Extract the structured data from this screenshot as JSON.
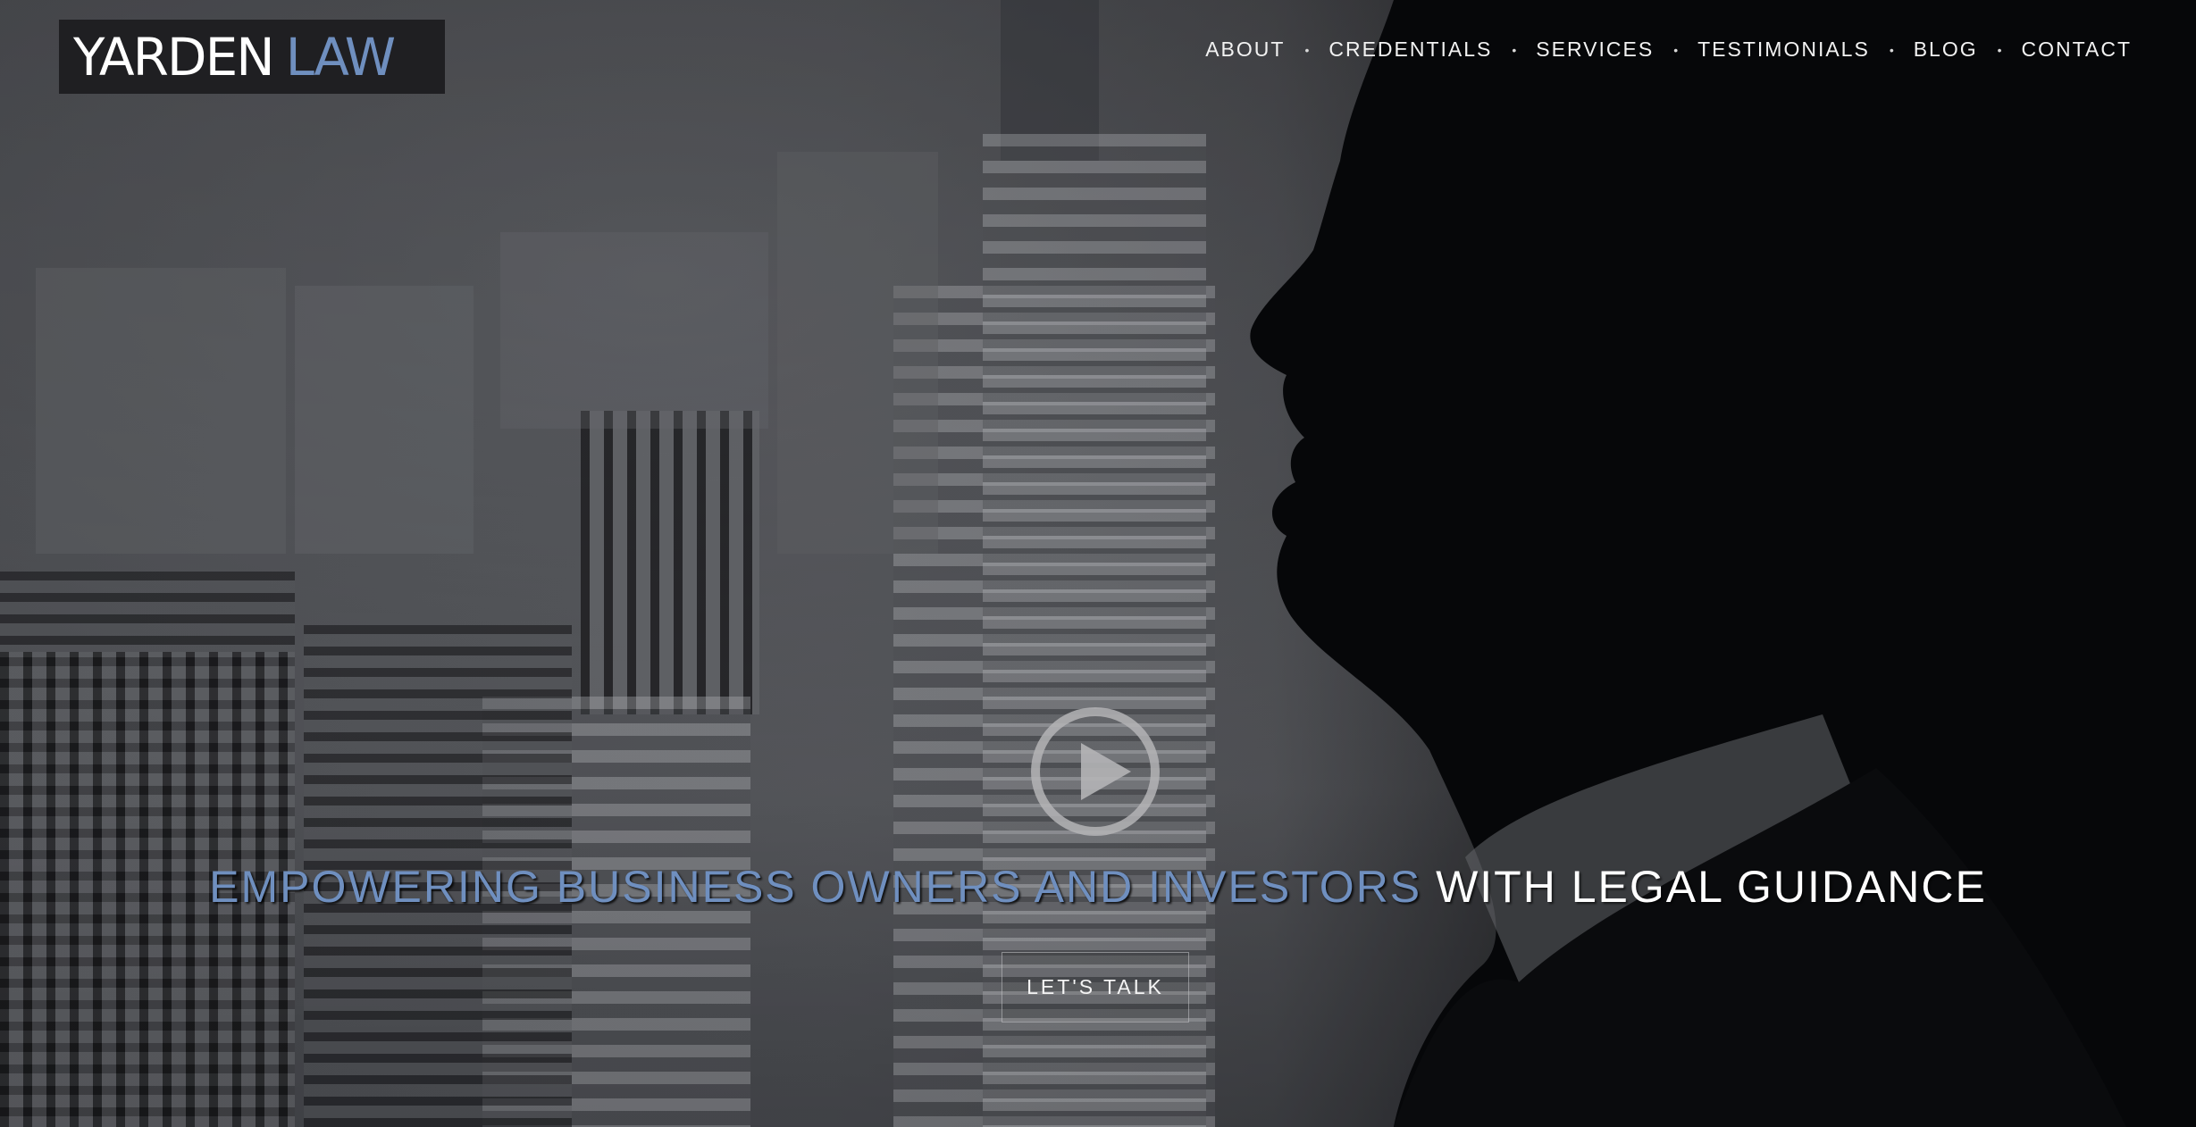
{
  "brand": {
    "name_part1": "YARDEN",
    "name_part2": "LAW",
    "accent_color": "#6f8fbf"
  },
  "nav": {
    "items": [
      {
        "label": "ABOUT"
      },
      {
        "label": "CREDENTIALS"
      },
      {
        "label": "SERVICES"
      },
      {
        "label": "TESTIMONIALS"
      },
      {
        "label": "BLOG"
      },
      {
        "label": "CONTACT"
      }
    ],
    "separator": "•"
  },
  "hero": {
    "play_icon": "play-circle-icon",
    "headline_accent": "EMPOWERING BUSINESS OWNERS AND INVESTORS",
    "headline_rest": "WITH LEGAL GUIDANCE",
    "cta_label": "LET'S TALK"
  }
}
